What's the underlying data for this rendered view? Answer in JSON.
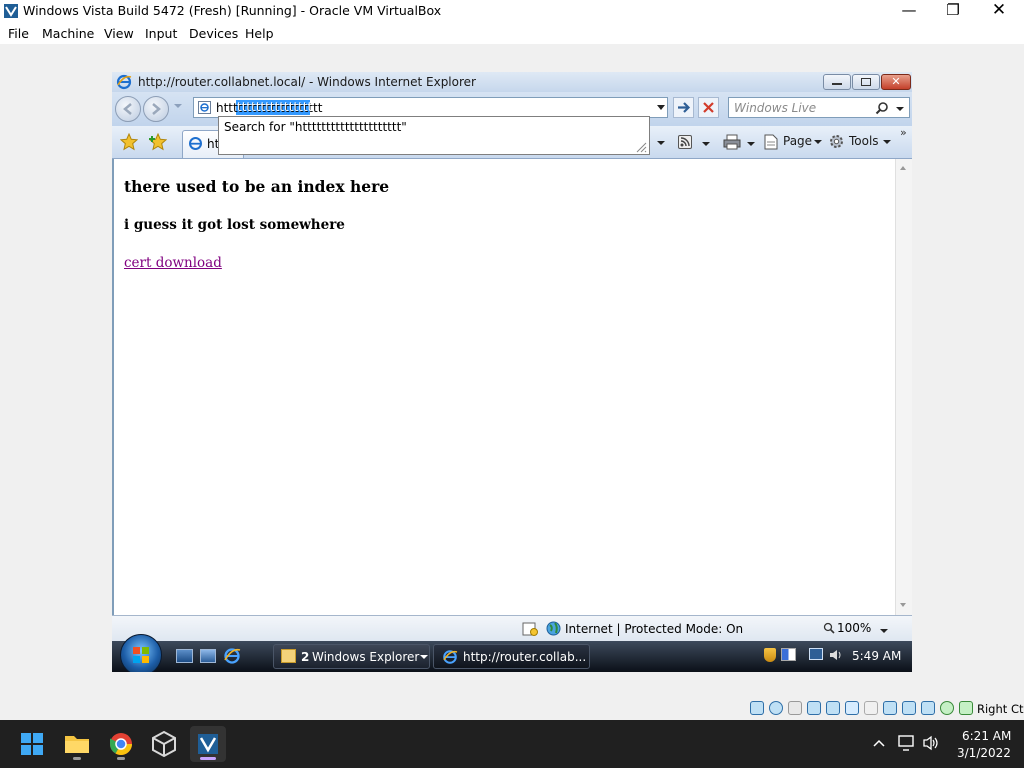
{
  "vbox": {
    "title": "Windows Vista Build 5472 (Fresh) [Running] - Oracle VM VirtualBox",
    "menu": [
      "File",
      "Machine",
      "View",
      "Input",
      "Devices",
      "Help"
    ],
    "host_key": "Right Ctrl"
  },
  "ie": {
    "title": "http://router.collabnet.local/ - Windows Internet Explorer",
    "address_value": "httttttttttttttttttttt",
    "address_selected_text": "ttttttttttttttttt",
    "autocomplete_text": "Search for \"httttttttttttttttttttt\"",
    "search_placeholder": "Windows Live",
    "tab_label": "htt",
    "commands": {
      "page": "Page",
      "tools": "Tools"
    },
    "status_zone": "Internet | Protected Mode: On",
    "zoom": "100%"
  },
  "page": {
    "heading": "there used to be an index here",
    "subheading": "i guess it got lost somewhere",
    "link": "cert download"
  },
  "vista_taskbar": {
    "explorer_group": {
      "count": "2",
      "label": "Windows Explorer"
    },
    "ie_task": "http://router.collab...",
    "clock": "5:49 AM"
  },
  "host_taskbar": {
    "time": "6:21 AM",
    "date": "3/1/2022"
  },
  "colors": {
    "selection": "#3399ff",
    "visited_link": "#800080",
    "ie_chrome": "#c6d7ec",
    "host_taskbar": "#202020"
  }
}
